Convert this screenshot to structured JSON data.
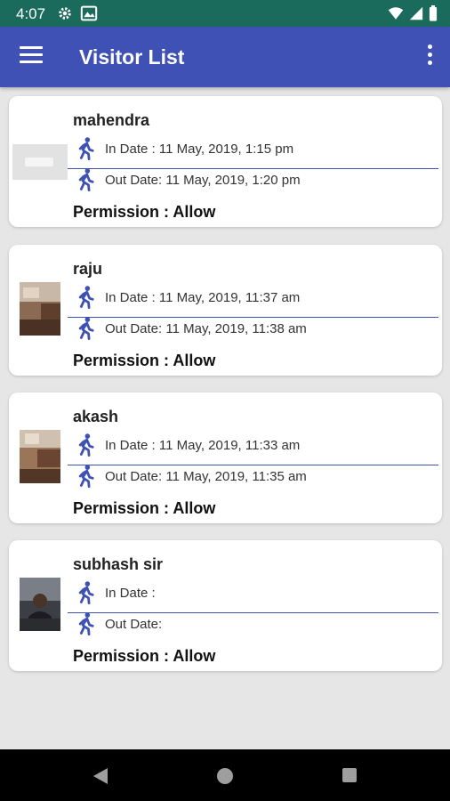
{
  "status_bar": {
    "time": "4:07",
    "icons_left": [
      "settings-icon",
      "photo-icon"
    ],
    "icons_right": [
      "wifi-icon",
      "signal-icon",
      "battery-icon"
    ]
  },
  "app_bar": {
    "title": "Visitor List",
    "menu_icon": "hamburger-menu-icon",
    "more_icon": "more-vert-icon"
  },
  "colors": {
    "status_bar": "#1b6b5c",
    "app_bar": "#3f51b5",
    "background": "#e6e6e6",
    "icon_accent": "#3f51b5"
  },
  "visitors": [
    {
      "name": "mahendra",
      "in_label": "In Date : 11 May, 2019, 1:15 pm",
      "out_label": "Out Date: 11 May, 2019, 1:20 pm",
      "permission": "Permission : Allow"
    },
    {
      "name": "raju",
      "in_label": "In Date : 11 May, 2019, 11:37 am",
      "out_label": "Out Date: 11 May, 2019, 11:38 am",
      "permission": "Permission : Allow"
    },
    {
      "name": "akash",
      "in_label": "In Date : 11 May, 2019, 11:33 am",
      "out_label": "Out Date: 11 May, 2019, 11:35 am",
      "permission": "Permission : Allow"
    },
    {
      "name": "subhash sir",
      "in_label": "In Date :",
      "out_label": "Out Date:",
      "permission": "Permission : Allow"
    }
  ]
}
